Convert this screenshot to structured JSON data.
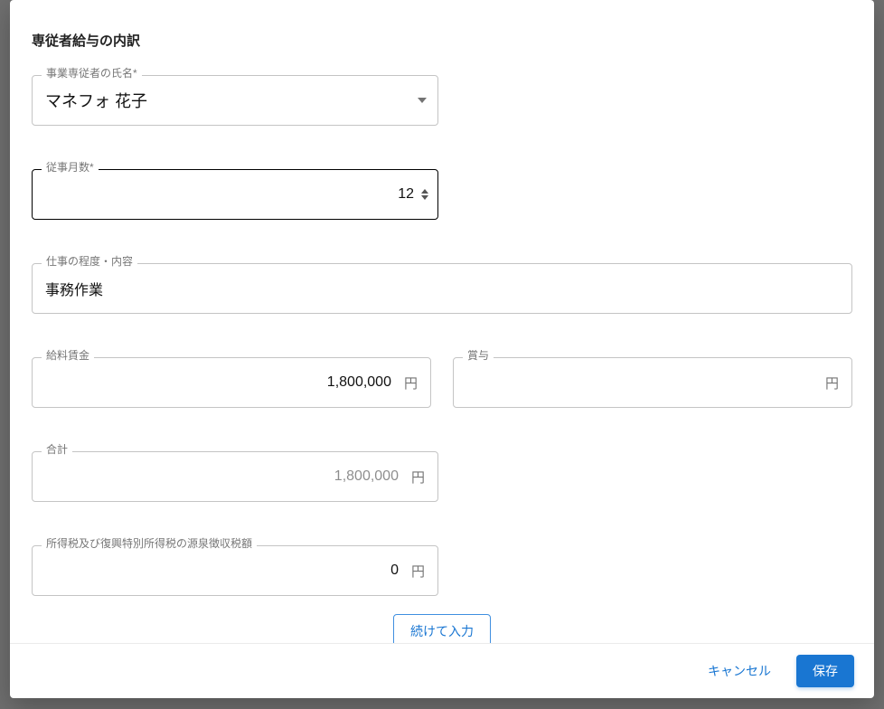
{
  "title": "専従者給与の内訳",
  "fields": {
    "name": {
      "label": "事業専従者の氏名*",
      "value": "マネフォ 花子"
    },
    "months": {
      "label": "従事月数*",
      "value": "12"
    },
    "work_content": {
      "label": "仕事の程度・内容",
      "value": "事務作業"
    },
    "salary": {
      "label": "給料賃金",
      "value": "1,800,000",
      "unit": "円"
    },
    "bonus": {
      "label": "賞与",
      "value": "",
      "unit": "円"
    },
    "total": {
      "label": "合計",
      "value": "1,800,000",
      "unit": "円"
    },
    "withholding_tax": {
      "label": "所得税及び復興特別所得税の源泉徴収税額",
      "value": "0",
      "unit": "円"
    }
  },
  "buttons": {
    "continue": "続けて入力",
    "cancel": "キャンセル",
    "save": "保存"
  }
}
